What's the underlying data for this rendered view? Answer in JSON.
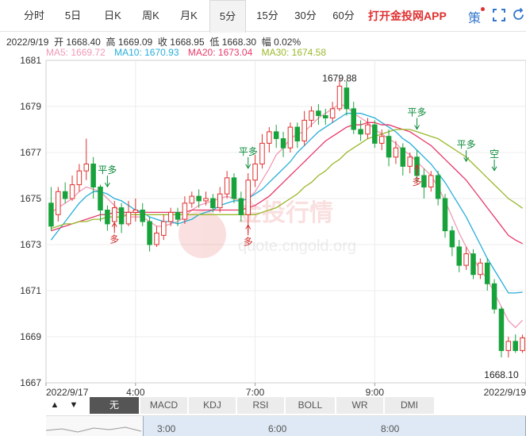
{
  "tabs": [
    "分时",
    "5日",
    "日K",
    "周K",
    "月K",
    "5分",
    "15分",
    "30分",
    "60分"
  ],
  "active_tab": "5分",
  "promo": "打开金投网APP",
  "ce_icon": "策",
  "info": {
    "date": "2022/9/19",
    "open_label": "开",
    "open": "1668.40",
    "high_label": "高",
    "high": "1669.09",
    "close_label": "收",
    "close": "1668.95",
    "low_label": "低",
    "low": "1668.30",
    "amp_label": "幅",
    "amp": "0.02%"
  },
  "ma": [
    {
      "label": "MA5:",
      "value": "1669.72",
      "color": "#f09ab4"
    },
    {
      "label": "MA10:",
      "value": "1670.93",
      "color": "#27aedb"
    },
    {
      "label": "MA20:",
      "value": "1673.04",
      "color": "#e83a6a"
    },
    {
      "label": "MA30:",
      "value": "1674.58",
      "color": "#99b82b"
    }
  ],
  "indicators": [
    "无",
    "MACD",
    "KDJ",
    "RSI",
    "BOLL",
    "WR",
    "DMI"
  ],
  "active_indicator": "无",
  "scroller_ticks": [
    "3:00",
    "6:00",
    "8:00"
  ],
  "watermark": {
    "cn": "金投行情",
    "url": "quote.cngold.org"
  },
  "chart_data": {
    "type": "candlestick",
    "ylim": [
      1667,
      1681
    ],
    "y_ticks": [
      "1681",
      "1679",
      "1677",
      "1675",
      "1673",
      "1671",
      "1669",
      "1667"
    ],
    "x_tick_labels": [
      "2022/9/17",
      "4:00",
      "7:00",
      "9:00",
      "2022/9/19"
    ],
    "candles": [
      [
        1674.8,
        1673.8,
        1675.5,
        1673.6
      ],
      [
        1674.3,
        1675.3,
        1675.5,
        1674.0
      ],
      [
        1675.3,
        1675.0,
        1675.7,
        1674.8
      ],
      [
        1675.0,
        1675.6,
        1676.0,
        1674.9
      ],
      [
        1675.6,
        1676.2,
        1676.5,
        1675.3
      ],
      [
        1676.2,
        1676.5,
        1677.6,
        1675.8
      ],
      [
        1676.5,
        1675.5,
        1676.8,
        1675.0
      ],
      [
        1675.5,
        1674.5,
        1675.6,
        1674.0
      ],
      [
        1674.5,
        1673.9,
        1674.7,
        1673.6
      ],
      [
        1674.0,
        1674.6,
        1674.9,
        1673.7
      ],
      [
        1674.6,
        1673.9,
        1674.8,
        1673.5
      ],
      [
        1673.9,
        1674.4,
        1674.9,
        1673.8
      ],
      [
        1674.4,
        1674.5,
        1675.0,
        1674.0
      ],
      [
        1674.5,
        1674.0,
        1674.8,
        1673.8
      ],
      [
        1674.0,
        1673.0,
        1674.2,
        1672.7
      ],
      [
        1673.0,
        1673.5,
        1673.8,
        1672.9
      ],
      [
        1673.4,
        1674.0,
        1674.3,
        1673.2
      ],
      [
        1674.0,
        1674.4,
        1674.6,
        1673.8
      ],
      [
        1674.4,
        1674.1,
        1674.6,
        1673.8
      ],
      [
        1674.1,
        1674.8,
        1675.1,
        1673.9
      ],
      [
        1674.8,
        1675.1,
        1675.3,
        1674.6
      ],
      [
        1675.1,
        1674.9,
        1675.4,
        1674.6
      ],
      [
        1674.9,
        1675.0,
        1675.3,
        1674.7
      ],
      [
        1675.0,
        1674.6,
        1675.2,
        1674.4
      ],
      [
        1674.6,
        1675.2,
        1675.5,
        1674.4
      ],
      [
        1675.2,
        1675.9,
        1676.2,
        1675.0
      ],
      [
        1675.9,
        1675.0,
        1676.1,
        1674.8
      ],
      [
        1675.0,
        1674.3,
        1675.3,
        1674.0
      ],
      [
        1674.3,
        1675.8,
        1676.1,
        1673.5
      ],
      [
        1675.8,
        1676.5,
        1676.9,
        1675.5
      ],
      [
        1676.5,
        1677.4,
        1677.8,
        1676.3
      ],
      [
        1677.4,
        1677.9,
        1678.1,
        1677.0
      ],
      [
        1677.9,
        1677.6,
        1678.2,
        1677.2
      ],
      [
        1677.6,
        1677.2,
        1677.9,
        1676.8
      ],
      [
        1677.2,
        1678.1,
        1678.3,
        1677.0
      ],
      [
        1678.1,
        1677.5,
        1678.3,
        1677.2
      ],
      [
        1677.5,
        1678.4,
        1678.8,
        1677.3
      ],
      [
        1678.4,
        1678.8,
        1679.0,
        1678.1
      ],
      [
        1678.8,
        1678.6,
        1679.1,
        1678.2
      ],
      [
        1678.6,
        1678.5,
        1678.9,
        1678.2
      ],
      [
        1678.5,
        1678.9,
        1679.2,
        1678.3
      ],
      [
        1678.9,
        1679.88,
        1680.2,
        1678.8
      ],
      [
        1679.8,
        1678.9,
        1680.1,
        1678.6
      ],
      [
        1678.9,
        1678.0,
        1679.2,
        1677.8
      ],
      [
        1678.0,
        1677.8,
        1678.4,
        1677.5
      ],
      [
        1677.8,
        1678.2,
        1678.5,
        1677.6
      ],
      [
        1678.2,
        1677.4,
        1678.4,
        1677.2
      ],
      [
        1677.4,
        1677.7,
        1678.0,
        1677.1
      ],
      [
        1677.7,
        1676.8,
        1678.0,
        1676.4
      ],
      [
        1676.8,
        1677.2,
        1677.5,
        1676.5
      ],
      [
        1677.2,
        1676.4,
        1677.4,
        1676.0
      ],
      [
        1676.4,
        1676.8,
        1677.0,
        1676.1
      ],
      [
        1676.8,
        1676.0,
        1677.1,
        1675.7
      ],
      [
        1676.0,
        1675.5,
        1676.3,
        1675.0
      ],
      [
        1675.5,
        1676.0,
        1676.2,
        1675.3
      ],
      [
        1676.0,
        1675.0,
        1676.2,
        1674.7
      ],
      [
        1675.0,
        1673.6,
        1675.2,
        1673.3
      ],
      [
        1673.6,
        1672.9,
        1673.8,
        1672.5
      ],
      [
        1672.9,
        1672.1,
        1673.2,
        1671.8
      ],
      [
        1672.1,
        1672.6,
        1672.9,
        1671.9
      ],
      [
        1672.6,
        1671.7,
        1672.8,
        1671.5
      ],
      [
        1671.7,
        1672.2,
        1672.4,
        1671.5
      ],
      [
        1672.2,
        1671.3,
        1672.4,
        1671.0
      ],
      [
        1671.3,
        1670.2,
        1671.5,
        1670.0
      ],
      [
        1670.2,
        1668.4,
        1670.3,
        1668.1
      ],
      [
        1668.4,
        1668.8,
        1669.0,
        1668.1
      ],
      [
        1668.8,
        1668.4,
        1669.1,
        1668.3
      ],
      [
        1668.4,
        1668.95,
        1669.09,
        1668.3
      ]
    ],
    "series": [
      {
        "name": "MA5",
        "color": "#f09ab4",
        "values": [
          1674.4,
          1674.6,
          1674.8,
          1675.0,
          1675.3,
          1675.5,
          1675.4,
          1675.3,
          1675.0,
          1674.7,
          1674.4,
          1674.2,
          1674.2,
          1674.2,
          1674.0,
          1673.8,
          1673.8,
          1673.9,
          1674.0,
          1674.2,
          1674.5,
          1674.7,
          1674.8,
          1674.9,
          1675.0,
          1675.1,
          1675.0,
          1674.9,
          1675.0,
          1675.3,
          1675.8,
          1676.3,
          1676.9,
          1677.2,
          1677.6,
          1677.8,
          1677.9,
          1678.2,
          1678.5,
          1678.7,
          1678.9,
          1679.1,
          1679.0,
          1678.7,
          1678.5,
          1678.3,
          1678.0,
          1677.8,
          1677.6,
          1677.4,
          1677.1,
          1676.9,
          1676.6,
          1676.3,
          1676.0,
          1675.5,
          1674.9,
          1674.2,
          1673.5,
          1672.9,
          1672.4,
          1671.9,
          1671.5,
          1670.9,
          1670.3,
          1669.7,
          1669.4,
          1669.72
        ]
      },
      {
        "name": "MA10",
        "color": "#27aedb",
        "values": [
          1673.2,
          1673.6,
          1674.0,
          1674.4,
          1674.8,
          1675.1,
          1675.3,
          1675.3,
          1675.2,
          1675.0,
          1674.9,
          1674.7,
          1674.5,
          1674.4,
          1674.2,
          1674.1,
          1674.0,
          1674.0,
          1673.9,
          1674.0,
          1674.1,
          1674.3,
          1674.4,
          1674.5,
          1674.7,
          1674.8,
          1674.9,
          1674.9,
          1675.0,
          1675.2,
          1675.4,
          1675.7,
          1676.0,
          1676.3,
          1676.6,
          1677.0,
          1677.3,
          1677.6,
          1677.9,
          1678.1,
          1678.3,
          1678.5,
          1678.7,
          1678.7,
          1678.7,
          1678.6,
          1678.5,
          1678.3,
          1678.1,
          1677.9,
          1677.6,
          1677.4,
          1677.1,
          1676.8,
          1676.5,
          1676.1,
          1675.7,
          1675.2,
          1674.7,
          1674.2,
          1673.6,
          1673.0,
          1672.4,
          1671.9,
          1671.4,
          1670.9,
          1670.9,
          1670.93
        ]
      },
      {
        "name": "MA20",
        "color": "#e83a6a",
        "values": [
          1673.6,
          1673.7,
          1673.8,
          1673.9,
          1674.0,
          1674.1,
          1674.2,
          1674.3,
          1674.3,
          1674.4,
          1674.4,
          1674.4,
          1674.4,
          1674.4,
          1674.4,
          1674.4,
          1674.4,
          1674.4,
          1674.4,
          1674.4,
          1674.5,
          1674.5,
          1674.5,
          1674.5,
          1674.5,
          1674.5,
          1674.5,
          1674.5,
          1674.6,
          1674.7,
          1674.9,
          1675.1,
          1675.4,
          1675.7,
          1676.0,
          1676.3,
          1676.6,
          1676.9,
          1677.2,
          1677.5,
          1677.7,
          1677.9,
          1678.1,
          1678.2,
          1678.2,
          1678.3,
          1678.3,
          1678.2,
          1678.2,
          1678.1,
          1678.0,
          1677.9,
          1677.7,
          1677.5,
          1677.3,
          1677.0,
          1676.7,
          1676.4,
          1676.1,
          1675.8,
          1675.4,
          1675.0,
          1674.6,
          1674.2,
          1673.8,
          1673.4,
          1673.2,
          1673.04
        ]
      },
      {
        "name": "MA30",
        "color": "#99b82b",
        "values": [
          1673.7,
          1673.8,
          1673.9,
          1673.9,
          1674.0,
          1674.0,
          1674.1,
          1674.1,
          1674.2,
          1674.2,
          1674.2,
          1674.3,
          1674.3,
          1674.3,
          1674.3,
          1674.3,
          1674.3,
          1674.3,
          1674.3,
          1674.3,
          1674.3,
          1674.3,
          1674.3,
          1674.3,
          1674.3,
          1674.3,
          1674.3,
          1674.3,
          1674.3,
          1674.3,
          1674.4,
          1674.5,
          1674.6,
          1674.8,
          1675.0,
          1675.2,
          1675.5,
          1675.7,
          1676.0,
          1676.2,
          1676.5,
          1676.7,
          1677.0,
          1677.2,
          1677.4,
          1677.6,
          1677.7,
          1677.8,
          1677.9,
          1678.0,
          1678.0,
          1678.0,
          1677.9,
          1677.8,
          1677.7,
          1677.6,
          1677.4,
          1677.2,
          1677.0,
          1676.8,
          1676.5,
          1676.2,
          1675.9,
          1675.6,
          1675.3,
          1675.0,
          1674.8,
          1674.58
        ]
      }
    ],
    "annotations": [
      {
        "text": "1679.88",
        "index": 41,
        "price": 1679.88
      },
      {
        "text": "1668.10",
        "index": 64,
        "price": 1668.1
      }
    ],
    "signals": [
      {
        "text": "平多",
        "index": 8,
        "price": 1676.1,
        "side": "above"
      },
      {
        "text": "多",
        "index": 9,
        "price": 1673.5,
        "side": "below"
      },
      {
        "text": "平多",
        "index": 28,
        "price": 1676.9,
        "side": "above"
      },
      {
        "text": "多",
        "index": 28,
        "price": 1673.4,
        "side": "below"
      },
      {
        "text": "平多",
        "index": 52,
        "price": 1678.6,
        "side": "above"
      },
      {
        "text": "多",
        "index": 52,
        "price": 1676.0,
        "side": "below"
      },
      {
        "text": "平多",
        "index": 59,
        "price": 1677.2,
        "side": "above"
      },
      {
        "text": "空",
        "index": 63,
        "price": 1676.8,
        "side": "above"
      }
    ],
    "up_color": "#e0312f",
    "down_color": "#18a23c",
    "grid": true
  }
}
